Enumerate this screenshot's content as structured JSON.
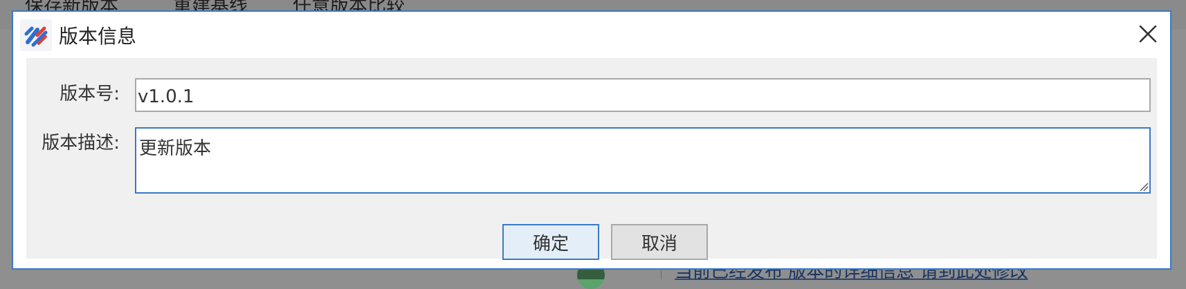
{
  "background": {
    "tabs": [
      "保存新版本",
      "重建基线",
      "任意版本比较"
    ],
    "link_text": "当前已经发布 版本的详细信息 请到此处修改"
  },
  "dialog": {
    "title": "版本信息",
    "icon": "app-logo-icon",
    "close_icon": "close-icon",
    "fields": {
      "version_label": "版本号:",
      "version_value": "v1.0.1",
      "description_label": "版本描述:",
      "description_value": "更新版本"
    },
    "buttons": {
      "ok_label": "确定",
      "cancel_label": "取消"
    }
  },
  "colors": {
    "accent": "#3a78c9",
    "panel": "#f0f0f0"
  }
}
